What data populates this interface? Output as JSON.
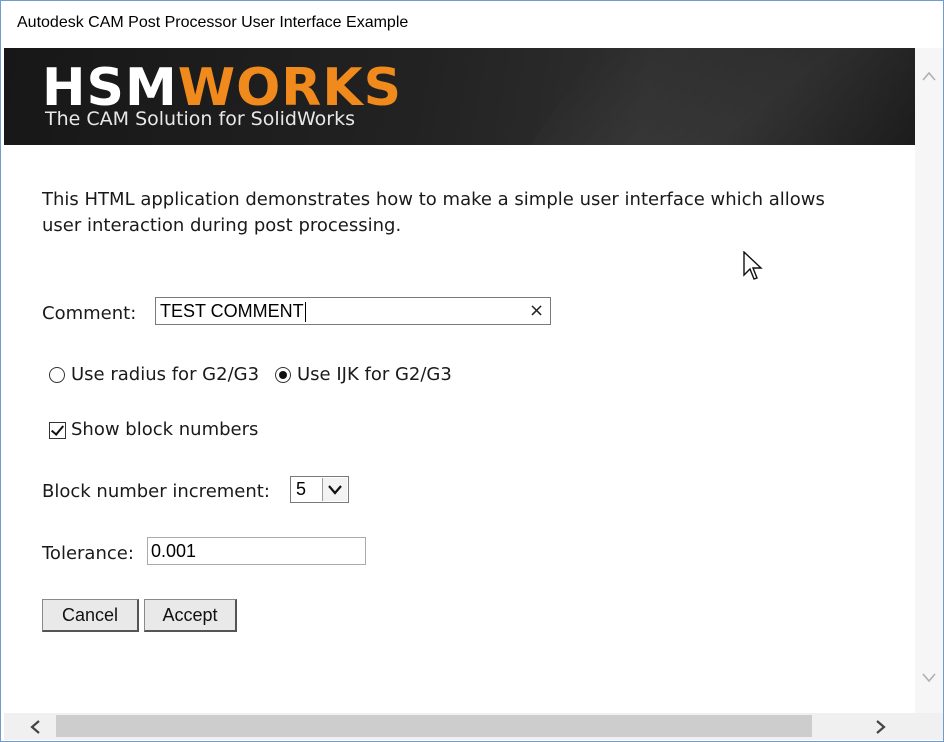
{
  "window": {
    "title": "Autodesk CAM Post Processor User Interface Example"
  },
  "banner": {
    "logo_part1": "HSM",
    "logo_part2": "WORKS",
    "tagline": "The CAM Solution for SolidWorks",
    "accent_color": "#f08a1c"
  },
  "content": {
    "intro": "This HTML application demonstrates how to make a simple user interface which allows user interaction during post processing.",
    "comment": {
      "label": "Comment:",
      "value": "TEST COMMENT",
      "clear_icon": "×"
    },
    "arc_mode": {
      "options": [
        {
          "label": "Use radius for G2/G3",
          "checked": false
        },
        {
          "label": "Use IJK for G2/G3",
          "checked": true
        }
      ]
    },
    "show_block_numbers": {
      "label": "Show block numbers",
      "checked": true
    },
    "block_increment": {
      "label": "Block number increment:",
      "selected": "5"
    },
    "tolerance": {
      "label": "Tolerance:",
      "value": "0.001"
    },
    "buttons": {
      "cancel": "Cancel",
      "accept": "Accept"
    }
  },
  "icons": {
    "clear": "close-icon",
    "dropdown": "chevron-down-icon",
    "scroll_up": "chevron-up-icon",
    "scroll_down": "chevron-down-icon",
    "scroll_left": "chevron-left-icon",
    "scroll_right": "chevron-right-icon",
    "cursor": "mouse-pointer-icon"
  }
}
